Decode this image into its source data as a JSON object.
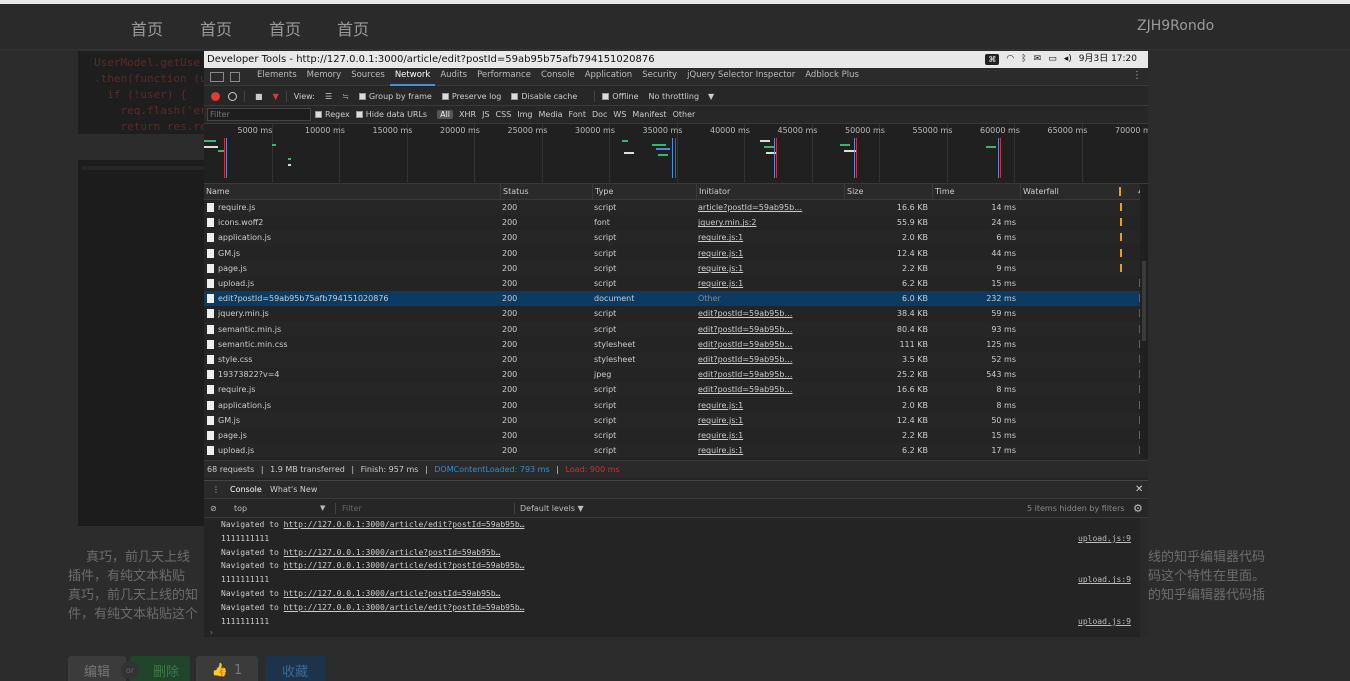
{
  "site": {
    "nav": [
      "首页",
      "首页",
      "首页",
      "首页"
    ],
    "user": "ZJH9Rondo"
  },
  "bg_code": [
    "UserModel.getUse",
    ".then(function (u",
    "  if (!user) {",
    "    req.flash('er",
    "    return res.re"
  ],
  "article": {
    "lines": [
      "真巧，前几天上线",
      "插件，有纯文本粘贴",
      "真巧，前几天上线的知",
      "件，有纯文本粘贴这个"
    ],
    "lines_right": [
      "线的知乎编辑器代码",
      "码这个特性在里面。",
      "的知乎编辑器代码插",
      ""
    ]
  },
  "actions": {
    "edit": "编辑",
    "or": "or",
    "delete": "删除",
    "like_count": "1",
    "favorite": "收藏"
  },
  "devtools": {
    "window_title": "Developer Tools - http://127.0.0.1:3000/article/edit?postId=59ab95b75afb794151020876",
    "system_clock": "9月3日 17:20",
    "tabs": [
      "Elements",
      "Memory",
      "Sources",
      "Network",
      "Audits",
      "Performance",
      "Console",
      "Application",
      "Security",
      "jQuery Selector Inspector",
      "Adblock Plus"
    ],
    "active_tab": "Network",
    "toolbar": {
      "view_label": "View:",
      "group_by_frame": "Group by frame",
      "preserve_log": "Preserve log",
      "disable_cache": "Disable cache",
      "offline": "Offline",
      "throttling": "No throttling"
    },
    "filter": {
      "placeholder": "Filter",
      "regex": "Regex",
      "hide_data_urls": "Hide data URLs",
      "types": [
        "All",
        "XHR",
        "JS",
        "CSS",
        "Img",
        "Media",
        "Font",
        "Doc",
        "WS",
        "Manifest",
        "Other"
      ]
    },
    "overview_ticks": [
      "5000 ms",
      "10000 ms",
      "15000 ms",
      "20000 ms",
      "25000 ms",
      "30000 ms",
      "35000 ms",
      "40000 ms",
      "45000 ms",
      "50000 ms",
      "55000 ms",
      "60000 ms",
      "65000 ms",
      "70000 ms"
    ],
    "columns": [
      "Name",
      "Status",
      "Type",
      "Initiator",
      "Size",
      "Time",
      "Waterfall"
    ],
    "requests": [
      {
        "name": "require.js",
        "status": "200",
        "type": "script",
        "initiator": "article?postId=59ab95b…",
        "size": "16.6 KB",
        "time": "14 ms"
      },
      {
        "name": "icons.woff2",
        "status": "200",
        "type": "font",
        "initiator": "jquery.min.js:2",
        "size": "55.9 KB",
        "time": "24 ms"
      },
      {
        "name": "application.js",
        "status": "200",
        "type": "script",
        "initiator": "require.js:1",
        "size": "2.0 KB",
        "time": "6 ms"
      },
      {
        "name": "GM.js",
        "status": "200",
        "type": "script",
        "initiator": "require.js:1",
        "size": "12.4 KB",
        "time": "44 ms"
      },
      {
        "name": "page.js",
        "status": "200",
        "type": "script",
        "initiator": "require.js:1",
        "size": "2.2 KB",
        "time": "9 ms"
      },
      {
        "name": "upload.js",
        "status": "200",
        "type": "script",
        "initiator": "require.js:1",
        "size": "6.2 KB",
        "time": "15 ms"
      },
      {
        "name": "edit?postId=59ab95b75afb794151020876",
        "status": "200",
        "type": "document",
        "initiator": "Other",
        "size": "6.0 KB",
        "time": "232 ms"
      },
      {
        "name": "jquery.min.js",
        "status": "200",
        "type": "script",
        "initiator": "edit?postId=59ab95b…",
        "size": "38.4 KB",
        "time": "59 ms"
      },
      {
        "name": "semantic.min.js",
        "status": "200",
        "type": "script",
        "initiator": "edit?postId=59ab95b…",
        "size": "80.4 KB",
        "time": "93 ms"
      },
      {
        "name": "semantic.min.css",
        "status": "200",
        "type": "stylesheet",
        "initiator": "edit?postId=59ab95b…",
        "size": "111 KB",
        "time": "125 ms"
      },
      {
        "name": "style.css",
        "status": "200",
        "type": "stylesheet",
        "initiator": "edit?postId=59ab95b…",
        "size": "3.5 KB",
        "time": "52 ms"
      },
      {
        "name": "19373822?v=4",
        "status": "200",
        "type": "jpeg",
        "initiator": "edit?postId=59ab95b…",
        "size": "25.2 KB",
        "time": "543 ms"
      },
      {
        "name": "require.js",
        "status": "200",
        "type": "script",
        "initiator": "edit?postId=59ab95b…",
        "size": "16.6 KB",
        "time": "8 ms"
      },
      {
        "name": "application.js",
        "status": "200",
        "type": "script",
        "initiator": "require.js:1",
        "size": "2.0 KB",
        "time": "8 ms"
      },
      {
        "name": "GM.js",
        "status": "200",
        "type": "script",
        "initiator": "require.js:1",
        "size": "12.4 KB",
        "time": "50 ms"
      },
      {
        "name": "page.js",
        "status": "200",
        "type": "script",
        "initiator": "require.js:1",
        "size": "2.2 KB",
        "time": "15 ms"
      },
      {
        "name": "upload.js",
        "status": "200",
        "type": "script",
        "initiator": "require.js:1",
        "size": "6.2 KB",
        "time": "17 ms"
      }
    ],
    "selected_row": 6,
    "summary": {
      "requests": "68 requests",
      "transferred": "1.9 MB transferred",
      "finish": "Finish: 957 ms",
      "dcl": "DOMContentLoaded: 793 ms",
      "load": "Load: 900 ms"
    },
    "drawer": {
      "tabs": [
        "Console",
        "What's New"
      ],
      "context": "top",
      "filter_placeholder": "Filter",
      "levels": "Default levels ▼",
      "hidden": "5 items hidden by filters"
    },
    "console_lines": [
      {
        "text": "Navigated to ",
        "link": "http://127.0.0.1:3000/article/edit?postId=59ab95b…",
        "source": ""
      },
      {
        "text": "1111111111",
        "link": "",
        "source": "upload.js:9"
      },
      {
        "text": "Navigated to ",
        "link": "http://127.0.0.1:3000/article?postId=59ab95b…",
        "source": ""
      },
      {
        "text": "Navigated to ",
        "link": "http://127.0.0.1:3000/article/edit?postId=59ab95b…",
        "source": ""
      },
      {
        "text": "1111111111",
        "link": "",
        "source": "upload.js:9"
      },
      {
        "text": "Navigated to ",
        "link": "http://127.0.0.1:3000/article?postId=59ab95b…",
        "source": ""
      },
      {
        "text": "Navigated to ",
        "link": "http://127.0.0.1:3000/article/edit?postId=59ab95b…",
        "source": ""
      },
      {
        "text": "1111111111",
        "link": "",
        "source": "upload.js:9"
      }
    ]
  }
}
